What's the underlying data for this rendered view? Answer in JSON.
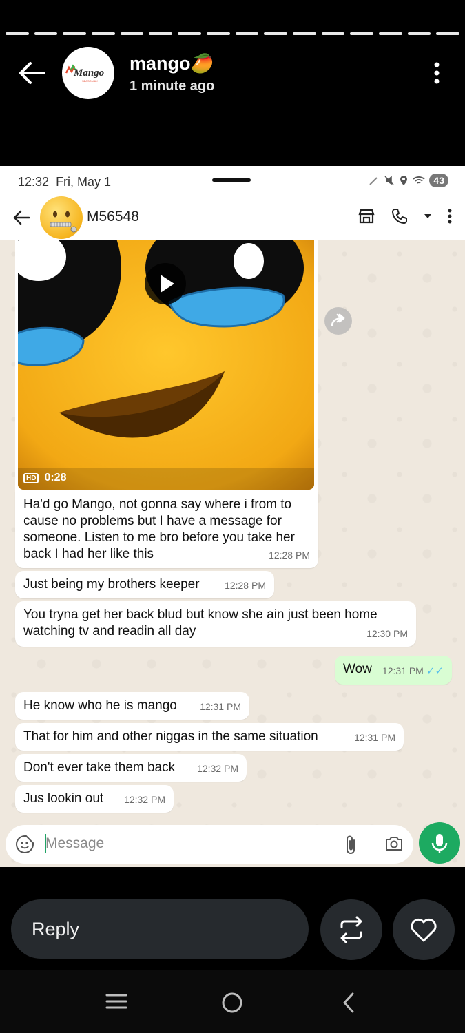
{
  "story": {
    "username": "mango",
    "username_emoji": "🥭",
    "posted": "1 minute ago",
    "avatar_logo_text": "Mango",
    "avatar_logo_subtext": "SEASON 6X",
    "icons": {
      "back": "arrow-left-icon",
      "more": "more-vertical-icon"
    }
  },
  "screenshot": {
    "status_bar": {
      "time": "12:32",
      "date": "Fri, May 1",
      "battery": "43"
    },
    "chat_header": {
      "contact_name": "M56548",
      "icons": [
        "back-arrow-icon",
        "store-icon",
        "phone-icon",
        "chevron-down-icon",
        "more-vertical-icon"
      ]
    },
    "video": {
      "quality": "HD",
      "duration": "0:28"
    },
    "messages": [
      {
        "direction": "in",
        "text": "Ha'd go Mango, not gonna say where i from to cause no problems but I have a message for someone. Listen to me bro before you take her back I had her like this",
        "time": "12:28 PM"
      },
      {
        "direction": "in",
        "text": "Just being my brothers keeper",
        "time": "12:28 PM"
      },
      {
        "direction": "in",
        "text": "You tryna get her back blud but know she ain just been home watching tv and readin all day",
        "time": "12:30 PM"
      },
      {
        "direction": "out",
        "text": "Wow",
        "time": "12:31 PM",
        "status": "read"
      },
      {
        "direction": "in",
        "text": "He know who he is mango",
        "time": "12:31 PM"
      },
      {
        "direction": "in",
        "text": "That for him and other niggas in the same situation",
        "time": "12:31 PM"
      },
      {
        "direction": "in",
        "text": "Don't ever take them back",
        "time": "12:32 PM"
      },
      {
        "direction": "in",
        "text": "Jus lookin out",
        "time": "12:32 PM"
      }
    ],
    "composer": {
      "placeholder": "Message"
    }
  },
  "footer": {
    "reply_label": "Reply",
    "icons": [
      "repost-icon",
      "heart-icon"
    ]
  },
  "colors": {
    "accent_green": "#1daa61",
    "outgoing_bubble": "#d9fdd3",
    "read_ticks": "#53bdeb"
  }
}
